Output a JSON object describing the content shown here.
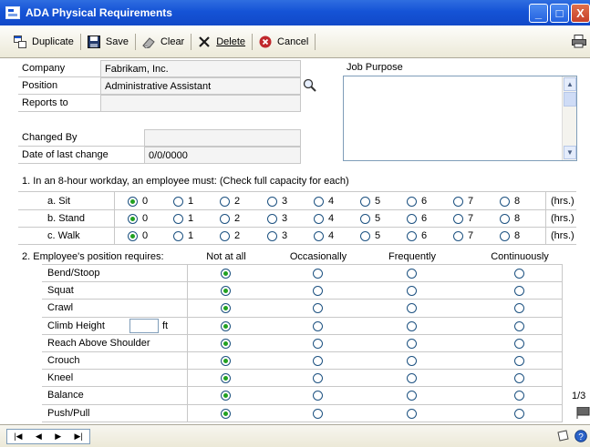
{
  "window": {
    "title": "ADA Physical Requirements",
    "buttons": {
      "minimize": "_",
      "maximize": "□",
      "close": "X"
    }
  },
  "toolbar": {
    "duplicate": "Duplicate",
    "save": "Save",
    "clear": "Clear",
    "delete": "Delete",
    "cancel": "Cancel"
  },
  "header": {
    "company_label": "Company",
    "company_value": "Fabrikam, Inc.",
    "position_label": "Position",
    "position_value": "Administrative Assistant",
    "reports_to_label": "Reports to",
    "reports_to_value": "",
    "changed_by_label": "Changed By",
    "changed_by_value": "",
    "date_label": "Date of last change",
    "date_value": "0/0/0000",
    "job_purpose_label": "Job Purpose"
  },
  "section1": {
    "title": "1.  In an 8-hour workday, an employee must:  (Check full capacity for each)",
    "options": [
      "0",
      "1",
      "2",
      "3",
      "4",
      "5",
      "6",
      "7",
      "8"
    ],
    "unit": "(hrs.)",
    "rows": [
      {
        "label": "a. Sit",
        "selected": 0
      },
      {
        "label": "b. Stand",
        "selected": 0
      },
      {
        "label": "c. Walk",
        "selected": 0
      }
    ]
  },
  "section2": {
    "title": "2.  Employee's position requires:",
    "columns": [
      "Not at all",
      "Occasionally",
      "Frequently",
      "Continuously"
    ],
    "height_unit": "ft",
    "height_value": "",
    "rows": [
      {
        "label": "Bend/Stoop",
        "selected": 0
      },
      {
        "label": "Squat",
        "selected": 0
      },
      {
        "label": "Crawl",
        "selected": 0
      },
      {
        "label": "Climb Height",
        "selected": 0
      },
      {
        "label": "Reach Above Shoulder",
        "selected": 0
      },
      {
        "label": "Crouch",
        "selected": 0
      },
      {
        "label": "Kneel",
        "selected": 0
      },
      {
        "label": "Balance",
        "selected": 0
      },
      {
        "label": "Push/Pull",
        "selected": 0
      }
    ]
  },
  "page_indicator": "1/3",
  "nav": {
    "first": "|◀",
    "prev": "◀",
    "next": "▶",
    "last": "▶|"
  },
  "colors": {
    "titlebar": "#1553d6",
    "radio_dot": "#21a121",
    "toolbar": "#ece9d8"
  }
}
